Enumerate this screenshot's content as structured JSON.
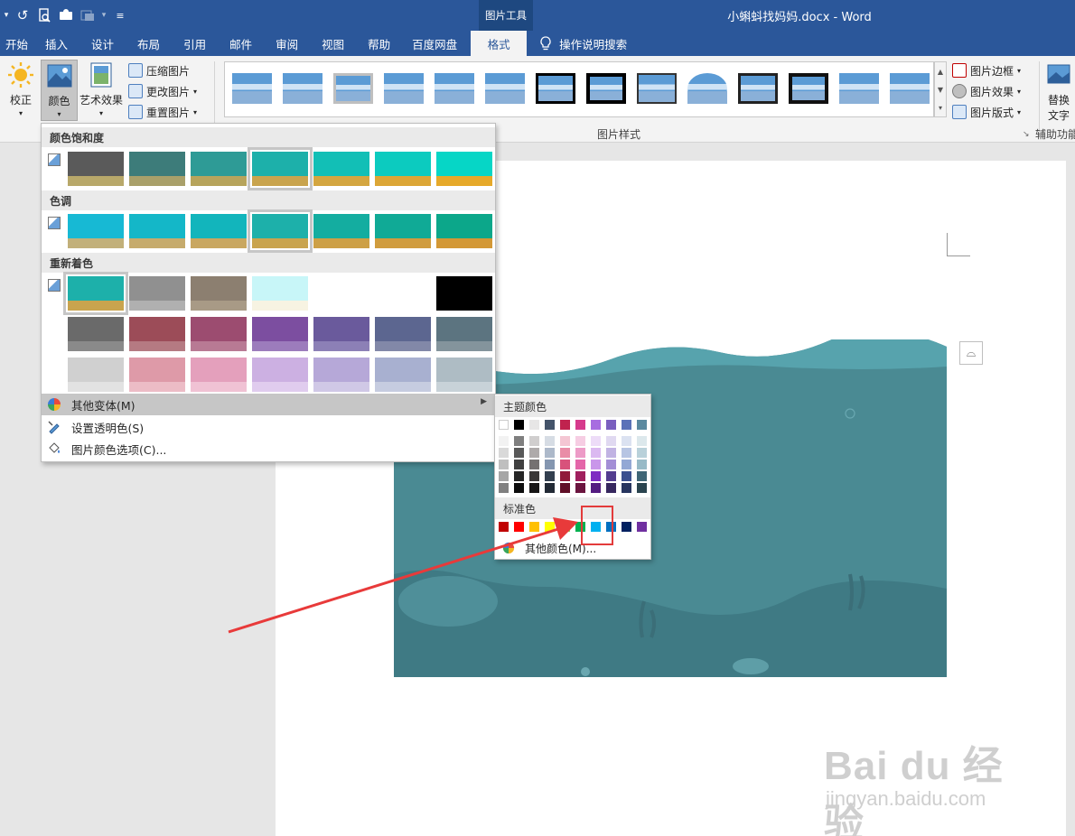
{
  "window": {
    "title": "小蝌蚪找妈妈.docx  -  Word",
    "context_tool": "图片工具"
  },
  "qat": {
    "icons": [
      "undo-icon",
      "print-preview-icon",
      "touch-mode-icon",
      "more-icon",
      "customize-icon"
    ]
  },
  "tabs": [
    {
      "label": "开始"
    },
    {
      "label": "插入"
    },
    {
      "label": "设计"
    },
    {
      "label": "布局"
    },
    {
      "label": "引用"
    },
    {
      "label": "邮件"
    },
    {
      "label": "审阅"
    },
    {
      "label": "视图"
    },
    {
      "label": "帮助"
    },
    {
      "label": "百度网盘"
    },
    {
      "label": "格式",
      "active": true
    }
  ],
  "tell_me": "操作说明搜索",
  "ribbon": {
    "correct": "校正",
    "color": "颜色",
    "artistic": "艺术效果",
    "compress": "压缩图片",
    "change": "更改图片",
    "reset": "重置图片",
    "picture_border": "图片边框",
    "picture_effects": "图片效果",
    "picture_layout": "图片版式",
    "alt_text": "替换",
    "alt_text2": "文字",
    "group_styles": "图片样式",
    "group_aux": "辅助功能"
  },
  "color_panel": {
    "saturation": "颜色饱和度",
    "tone": "色调",
    "recolor": "重新着色",
    "more_variations": "其他变体(M)",
    "set_transparent": "设置透明色(S)",
    "color_options": "图片颜色选项(C)...",
    "saturation_swatches": [
      [
        "#5a5a5a",
        "#b8a86a"
      ],
      [
        "#3d7c7a",
        "#a9a06a"
      ],
      [
        "#2e9b96",
        "#b7a45c"
      ],
      [
        "#1db0aa",
        "#c9a44e"
      ],
      [
        "#12bfb6",
        "#d4a640"
      ],
      [
        "#0ccbbf",
        "#dca636"
      ],
      [
        "#06d6c6",
        "#e6a92a"
      ]
    ],
    "tone_swatches": [
      [
        "#17b9d4",
        "#c2b07a"
      ],
      [
        "#14b7c8",
        "#c6ab6c"
      ],
      [
        "#12b5bc",
        "#c9a760"
      ],
      [
        "#1db0aa",
        "#c9a44e"
      ],
      [
        "#14ada0",
        "#cda046"
      ],
      [
        "#10aa96",
        "#d09c3e"
      ],
      [
        "#0ca78a",
        "#d39836"
      ]
    ],
    "recolor_swatches": [
      [
        [
          "#1db0aa",
          "#c9a44e"
        ],
        [
          "#909090",
          "#b0b0b0"
        ],
        [
          "#8c7f70",
          "#a89a86"
        ],
        [
          "#c8f6f8",
          "#f7f3e2"
        ],
        [
          "#ffffff",
          "#ffffff"
        ],
        [
          "#ffffff",
          "#ffffff"
        ],
        [
          "#000000",
          "#000000"
        ]
      ],
      [
        [
          "#6a6a6a",
          "#8a8a8a"
        ],
        [
          "#9c4c58",
          "#b57a82"
        ],
        [
          "#9c4c70",
          "#b87a94"
        ],
        [
          "#7c4ea0",
          "#9c7cbc"
        ],
        [
          "#6a5a9c",
          "#8c80b6"
        ],
        [
          "#5c6690",
          "#8288a8"
        ],
        [
          "#5c7480",
          "#84949c"
        ]
      ],
      [
        [
          "#d0d0d0",
          "#e2e2e2"
        ],
        [
          "#de9aa8",
          "#ecbcc6"
        ],
        [
          "#e4a0bc",
          "#f0c2d4"
        ],
        [
          "#ccb0e2",
          "#e0ccee"
        ],
        [
          "#b6a8d8",
          "#d0c8e6"
        ],
        [
          "#a8b0d0",
          "#c6cce0"
        ],
        [
          "#aebcc4",
          "#c8d2d8"
        ]
      ]
    ]
  },
  "submenu": {
    "theme_colors": "主题颜色",
    "standard_colors": "标准色",
    "more_colors": "其他颜色(M)...",
    "theme_top": [
      "#ffffff",
      "#000000",
      "#e7e6e6",
      "#44546a",
      "#c0234e",
      "#d63a8c",
      "#a76de0",
      "#7a5fbf",
      "#5a72b8",
      "#5b8aa0"
    ],
    "theme_columns": [
      [
        "#f2f2f2",
        "#d9d9d9",
        "#bfbfbf",
        "#a6a6a6",
        "#808080"
      ],
      [
        "#7f7f7f",
        "#595959",
        "#404040",
        "#262626",
        "#0d0d0d"
      ],
      [
        "#d0cece",
        "#aeaaaa",
        "#757171",
        "#3a3838",
        "#171616"
      ],
      [
        "#d6dce4",
        "#adb9ca",
        "#8496b0",
        "#333f4f",
        "#222a35"
      ],
      [
        "#f4c6d3",
        "#e98da7",
        "#d8527b",
        "#901a3a",
        "#600f27"
      ],
      [
        "#f6cde3",
        "#ed9bc7",
        "#e466a9",
        "#a0205e",
        "#6b153f"
      ],
      [
        "#eddcf8",
        "#dbb9f1",
        "#c996ea",
        "#7e2bc2",
        "#541c81"
      ],
      [
        "#e0d9f1",
        "#c1b3e3",
        "#a38ed6",
        "#533d8f",
        "#37285f"
      ],
      [
        "#dbe2f1",
        "#b7c5e3",
        "#93a8d5",
        "#3b508f",
        "#27355f"
      ],
      [
        "#dce8ec",
        "#b9d1da",
        "#97bac7",
        "#3f6676",
        "#2a444f"
      ]
    ],
    "standard": [
      "#c00000",
      "#ff0000",
      "#ffc000",
      "#ffff00",
      "#92d050",
      "#00b050",
      "#00b0f0",
      "#0070c0",
      "#002060",
      "#7030a0"
    ]
  },
  "watermark": {
    "main": "Bai du 经验",
    "sub": "jingyan.baidu.com"
  }
}
